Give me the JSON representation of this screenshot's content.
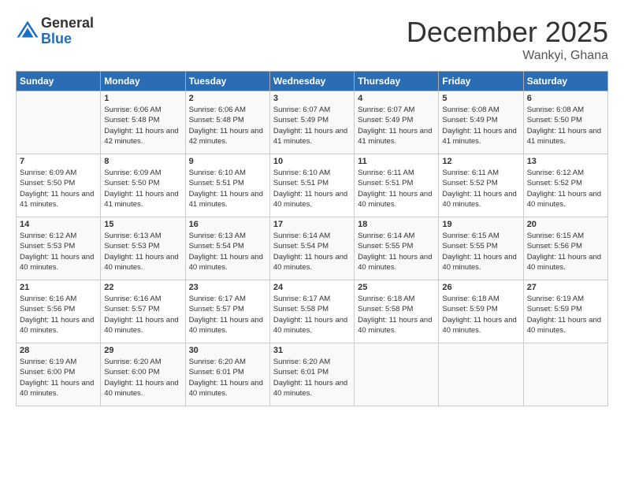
{
  "logo": {
    "general": "General",
    "blue": "Blue"
  },
  "title": "December 2025",
  "location": "Wankyi, Ghana",
  "days_of_week": [
    "Sunday",
    "Monday",
    "Tuesday",
    "Wednesday",
    "Thursday",
    "Friday",
    "Saturday"
  ],
  "weeks": [
    [
      {
        "day": null,
        "info": null
      },
      {
        "day": "1",
        "sunrise": "6:06 AM",
        "sunset": "5:48 PM",
        "daylight": "11 hours and 42 minutes."
      },
      {
        "day": "2",
        "sunrise": "6:06 AM",
        "sunset": "5:48 PM",
        "daylight": "11 hours and 42 minutes."
      },
      {
        "day": "3",
        "sunrise": "6:07 AM",
        "sunset": "5:49 PM",
        "daylight": "11 hours and 41 minutes."
      },
      {
        "day": "4",
        "sunrise": "6:07 AM",
        "sunset": "5:49 PM",
        "daylight": "11 hours and 41 minutes."
      },
      {
        "day": "5",
        "sunrise": "6:08 AM",
        "sunset": "5:49 PM",
        "daylight": "11 hours and 41 minutes."
      },
      {
        "day": "6",
        "sunrise": "6:08 AM",
        "sunset": "5:50 PM",
        "daylight": "11 hours and 41 minutes."
      }
    ],
    [
      {
        "day": "7",
        "sunrise": "6:09 AM",
        "sunset": "5:50 PM",
        "daylight": "11 hours and 41 minutes."
      },
      {
        "day": "8",
        "sunrise": "6:09 AM",
        "sunset": "5:50 PM",
        "daylight": "11 hours and 41 minutes."
      },
      {
        "day": "9",
        "sunrise": "6:10 AM",
        "sunset": "5:51 PM",
        "daylight": "11 hours and 41 minutes."
      },
      {
        "day": "10",
        "sunrise": "6:10 AM",
        "sunset": "5:51 PM",
        "daylight": "11 hours and 40 minutes."
      },
      {
        "day": "11",
        "sunrise": "6:11 AM",
        "sunset": "5:51 PM",
        "daylight": "11 hours and 40 minutes."
      },
      {
        "day": "12",
        "sunrise": "6:11 AM",
        "sunset": "5:52 PM",
        "daylight": "11 hours and 40 minutes."
      },
      {
        "day": "13",
        "sunrise": "6:12 AM",
        "sunset": "5:52 PM",
        "daylight": "11 hours and 40 minutes."
      }
    ],
    [
      {
        "day": "14",
        "sunrise": "6:12 AM",
        "sunset": "5:53 PM",
        "daylight": "11 hours and 40 minutes."
      },
      {
        "day": "15",
        "sunrise": "6:13 AM",
        "sunset": "5:53 PM",
        "daylight": "11 hours and 40 minutes."
      },
      {
        "day": "16",
        "sunrise": "6:13 AM",
        "sunset": "5:54 PM",
        "daylight": "11 hours and 40 minutes."
      },
      {
        "day": "17",
        "sunrise": "6:14 AM",
        "sunset": "5:54 PM",
        "daylight": "11 hours and 40 minutes."
      },
      {
        "day": "18",
        "sunrise": "6:14 AM",
        "sunset": "5:55 PM",
        "daylight": "11 hours and 40 minutes."
      },
      {
        "day": "19",
        "sunrise": "6:15 AM",
        "sunset": "5:55 PM",
        "daylight": "11 hours and 40 minutes."
      },
      {
        "day": "20",
        "sunrise": "6:15 AM",
        "sunset": "5:56 PM",
        "daylight": "11 hours and 40 minutes."
      }
    ],
    [
      {
        "day": "21",
        "sunrise": "6:16 AM",
        "sunset": "5:56 PM",
        "daylight": "11 hours and 40 minutes."
      },
      {
        "day": "22",
        "sunrise": "6:16 AM",
        "sunset": "5:57 PM",
        "daylight": "11 hours and 40 minutes."
      },
      {
        "day": "23",
        "sunrise": "6:17 AM",
        "sunset": "5:57 PM",
        "daylight": "11 hours and 40 minutes."
      },
      {
        "day": "24",
        "sunrise": "6:17 AM",
        "sunset": "5:58 PM",
        "daylight": "11 hours and 40 minutes."
      },
      {
        "day": "25",
        "sunrise": "6:18 AM",
        "sunset": "5:58 PM",
        "daylight": "11 hours and 40 minutes."
      },
      {
        "day": "26",
        "sunrise": "6:18 AM",
        "sunset": "5:59 PM",
        "daylight": "11 hours and 40 minutes."
      },
      {
        "day": "27",
        "sunrise": "6:19 AM",
        "sunset": "5:59 PM",
        "daylight": "11 hours and 40 minutes."
      }
    ],
    [
      {
        "day": "28",
        "sunrise": "6:19 AM",
        "sunset": "6:00 PM",
        "daylight": "11 hours and 40 minutes."
      },
      {
        "day": "29",
        "sunrise": "6:20 AM",
        "sunset": "6:00 PM",
        "daylight": "11 hours and 40 minutes."
      },
      {
        "day": "30",
        "sunrise": "6:20 AM",
        "sunset": "6:01 PM",
        "daylight": "11 hours and 40 minutes."
      },
      {
        "day": "31",
        "sunrise": "6:20 AM",
        "sunset": "6:01 PM",
        "daylight": "11 hours and 40 minutes."
      },
      {
        "day": null,
        "info": null
      },
      {
        "day": null,
        "info": null
      },
      {
        "day": null,
        "info": null
      }
    ]
  ]
}
